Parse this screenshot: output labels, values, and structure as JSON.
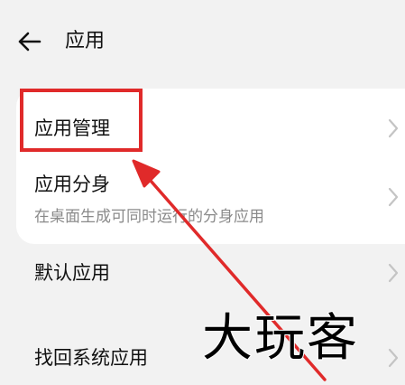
{
  "header": {
    "back_icon": "arrow-left-icon",
    "title": "应用"
  },
  "items": [
    {
      "title": "应用管理"
    },
    {
      "title": "应用分身",
      "subtitle": "在桌面生成可同时运行的分身应用"
    },
    {
      "title": "默认应用"
    },
    {
      "title": "找回系统应用"
    }
  ],
  "annotation": {
    "highlight_color": "#e02a2a",
    "watermark": "大玩客"
  }
}
